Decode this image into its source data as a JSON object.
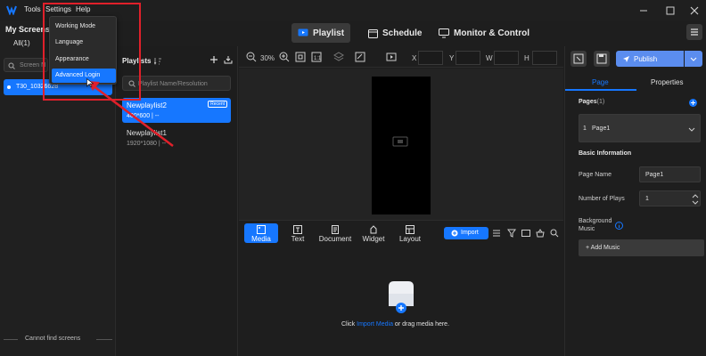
{
  "menu": {
    "tools": "Tools",
    "settings": "Settings",
    "help": "Help",
    "settings_items": [
      "Working Mode",
      "Language",
      "Appearance",
      "Advanced Login"
    ]
  },
  "screens": {
    "title": "My Screens",
    "filter_all": "All(1)",
    "search_placeholder": "Screen N",
    "items": [
      "T30_10326628"
    ],
    "footer": "Cannot find screens"
  },
  "main_tabs": [
    "Playlist",
    "Schedule",
    "Monitor & Control"
  ],
  "playlists": {
    "title": "Playlists",
    "search_placeholder": "Playlist Name/Resolution",
    "items": [
      {
        "name": "Newplaylist2",
        "meta": "400*600 | --",
        "badge": "Recent"
      },
      {
        "name": "Newplaylist1",
        "meta": "1920*1080 | --",
        "badge": ""
      }
    ]
  },
  "canvas_toolbar": {
    "zoom": "30%",
    "x_label": "X",
    "y_label": "Y",
    "w_label": "W",
    "h_label": "H"
  },
  "bottom_tabs": [
    "Media",
    "Text",
    "Document",
    "Widget",
    "Layout"
  ],
  "media": {
    "import_label": "Import",
    "empty_prefix": "Click ",
    "empty_link": "Import Media",
    "empty_suffix": " or drag media here."
  },
  "header_actions": {
    "publish": "Publish"
  },
  "props": {
    "tab_page": "Page",
    "tab_properties": "Properties",
    "pages_label": "Pages",
    "pages_count": "(1)",
    "page_index": "1",
    "page_name_value": "Page1",
    "basic_info": "Basic Information",
    "page_name_label": "Page Name",
    "page_name_input": "Page1",
    "plays_label": "Number of Plays",
    "plays_value": "1",
    "bgm_label": "Background Music",
    "add_music": "+ Add Music"
  },
  "colors": {
    "accent": "#1677ff",
    "annotation": "#e0202a"
  }
}
